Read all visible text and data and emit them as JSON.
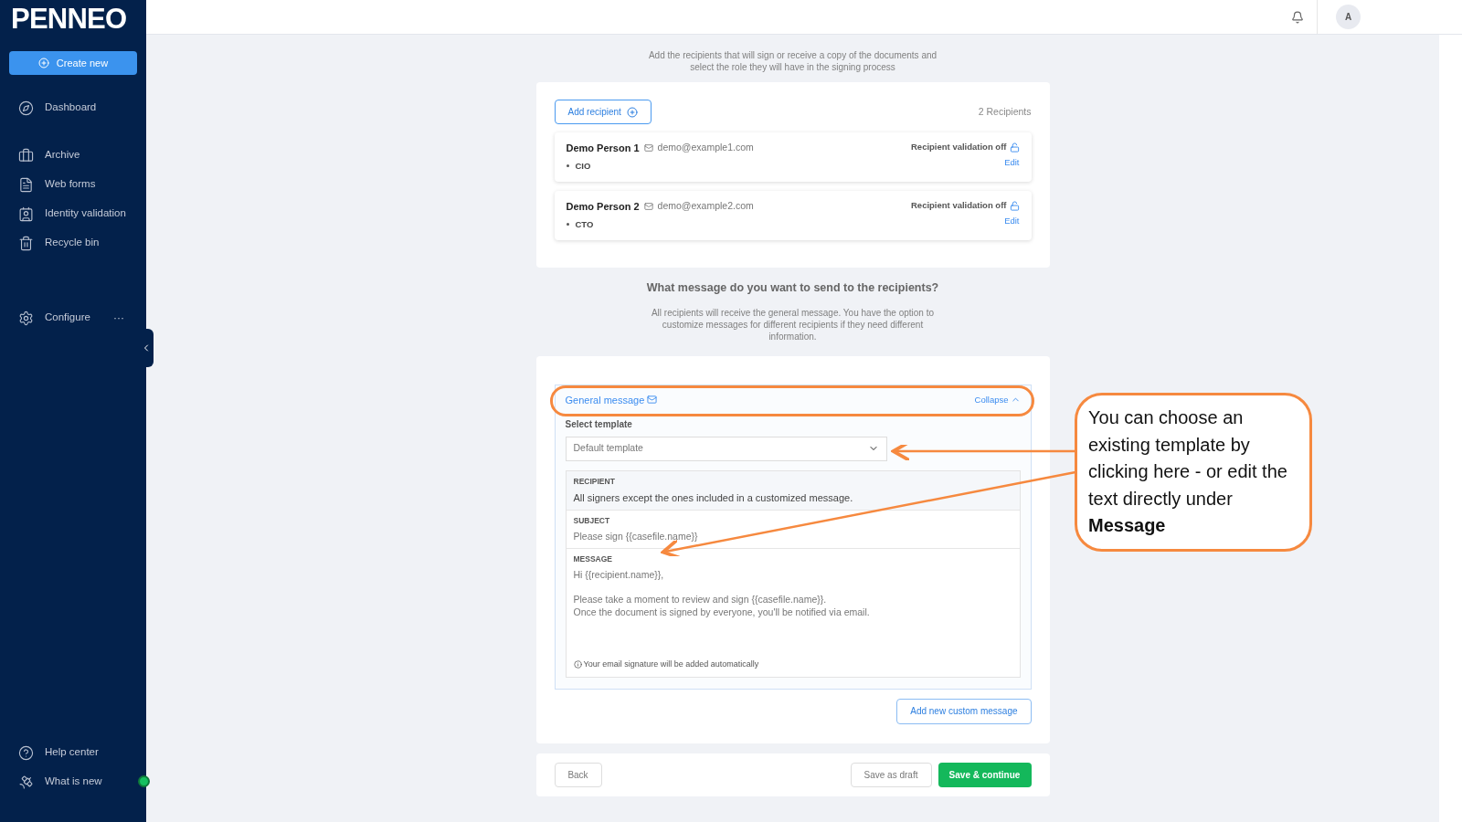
{
  "sidebar": {
    "logo": "PENNEO",
    "create_button": "Create new",
    "items": [
      {
        "label": "Dashboard"
      },
      {
        "label": "Archive"
      },
      {
        "label": "Web forms"
      },
      {
        "label": "Identity validation"
      },
      {
        "label": "Recycle bin"
      },
      {
        "label": "Configure",
        "more": "···"
      }
    ],
    "bottom_items": [
      {
        "label": "Help center",
        "status": false
      },
      {
        "label": "What is new",
        "status": true
      }
    ]
  },
  "header": {
    "avatar": "A"
  },
  "recipients_section": {
    "description": "Add the recipients that will sign or receive a copy of the documents and select the role they will have in the signing process",
    "add_button": "Add recipient",
    "count": "2 Recipients",
    "recipients": [
      {
        "name": "Demo Person 1",
        "email": "demo@example1.com",
        "role": "CIO",
        "validation": "Recipient validation off",
        "edit": "Edit"
      },
      {
        "name": "Demo Person 2",
        "email": "demo@example2.com",
        "role": "CTO",
        "validation": "Recipient validation off",
        "edit": "Edit"
      }
    ]
  },
  "message_section": {
    "title": "What message do you want to send to the recipients?",
    "description": "All recipients will receive the general message. You have the option to customize messages for different recipients if they need different information.",
    "general_message": {
      "title": "General message",
      "collapse": "Collapse",
      "expanded": true,
      "template_label": "Select template",
      "template_value": "Default template",
      "recipient_label": "RECIPIENT",
      "recipient_value": "All signers except the ones included in a customized message.",
      "subject_label": "SUBJECT",
      "subject_value": "Please sign {{casefile.name}}",
      "message_label": "MESSAGE",
      "message_paragraphs": [
        {
          "lines": [
            "Hi {{recipient.name}},"
          ]
        },
        {
          "lines": [
            "Please take a moment to review and sign {{casefile.name}}.",
            "Once the document is signed by everyone, you'll be notified via email."
          ]
        }
      ],
      "signature_note": "Your email signature will be added automatically"
    },
    "add_custom_button": "Add new custom message"
  },
  "footer": {
    "back": "Back",
    "save_draft": "Save as draft",
    "save_continue": "Save & continue"
  },
  "callout": {
    "text": "You can choose an existing template by clicking here - or edit the text directly under **Message**"
  }
}
